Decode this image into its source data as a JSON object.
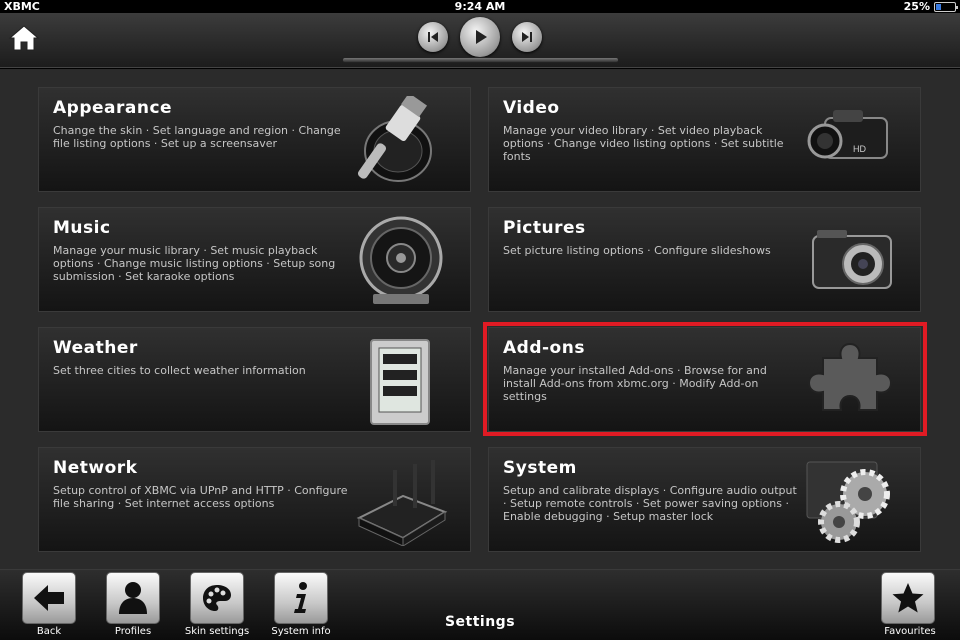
{
  "status_bar": {
    "app_name": "XBMC",
    "time": "9:24 AM",
    "battery": "25%",
    "battery_level": 0.25
  },
  "main": {
    "cards": [
      {
        "title": "Appearance",
        "description": "Change the skin · Set language and region · Change file listing options · Set up a screensaver",
        "icon": "paintbrush-icon"
      },
      {
        "title": "Video",
        "description": "Manage your video library · Set video playback options · Change video listing options · Set subtitle fonts",
        "icon": "camcorder-icon"
      },
      {
        "title": "Music",
        "description": "Manage your music library · Set music playback options · Change music listing options · Setup song submission · Set karaoke options",
        "icon": "speaker-icon"
      },
      {
        "title": "Pictures",
        "description": "Set picture listing options · Configure slideshows",
        "icon": "camera-icon"
      },
      {
        "title": "Weather",
        "description": "Set three cities to collect weather information",
        "icon": "weather-station-icon"
      },
      {
        "title": "Add-ons",
        "description": "Manage your installed Add-ons · Browse for and install Add-ons from xbmc.org · Modify Add-on settings",
        "icon": "puzzle-piece-icon"
      },
      {
        "title": "Network",
        "description": "Setup control of XBMC via UPnP and HTTP · Configure file sharing · Set internet access options",
        "icon": "router-icon"
      },
      {
        "title": "System",
        "description": "Setup and calibrate displays · Configure audio output · Setup remote controls · Set power saving options · Enable debugging · Setup master lock",
        "icon": "gears-icon"
      }
    ],
    "highlighted": "Add-ons"
  },
  "bottom_bar": {
    "title": "Settings",
    "buttons": [
      {
        "label": "Back",
        "icon": "back-arrow-icon"
      },
      {
        "label": "Profiles",
        "icon": "person-icon"
      },
      {
        "label": "Skin settings",
        "icon": "palette-icon"
      },
      {
        "label": "System info",
        "icon": "info-icon"
      },
      {
        "label": "Favourites",
        "icon": "star-icon"
      }
    ]
  },
  "colors": {
    "highlight": "#e01b24",
    "accent_blue": "#3a7be0"
  }
}
